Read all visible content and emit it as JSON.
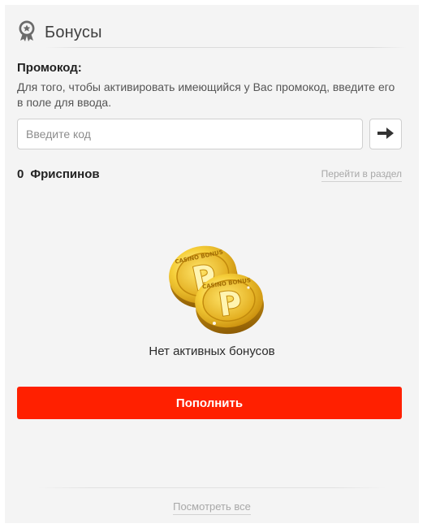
{
  "header": {
    "title": "Бонусы",
    "icon": "award-badge-icon"
  },
  "promo": {
    "title": "Промокод:",
    "description": "Для того, чтобы активировать имеющийся у Вас промокод, введите его в поле для ввода.",
    "input_placeholder": "Введите код",
    "input_value": "",
    "submit_icon": "arrow-right-icon"
  },
  "freespins": {
    "count": "0",
    "label": "Фриспинов",
    "link": "Перейти в раздел"
  },
  "empty_state": {
    "image": "casino-bonus-coins",
    "coin_text": "CASINO BONUS",
    "text": "Нет активных бонусов"
  },
  "actions": {
    "deposit_label": "Пополнить"
  },
  "footer": {
    "view_all": "Посмотреть все"
  },
  "colors": {
    "accent": "#ff2000",
    "panel_bg": "#f4f4f4",
    "gold": "#f2c230"
  }
}
